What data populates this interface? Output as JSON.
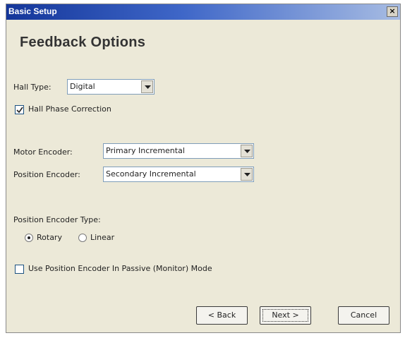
{
  "window": {
    "title": "Basic Setup",
    "close_glyph": "×"
  },
  "heading": "Feedback Options",
  "hall_type": {
    "label": "Hall Type:",
    "value": "Digital"
  },
  "hall_phase_correction": {
    "label": "Hall Phase Correction",
    "checked": true
  },
  "motor_encoder": {
    "label": "Motor Encoder:",
    "value": "Primary Incremental"
  },
  "position_encoder": {
    "label": "Position Encoder:",
    "value": "Secondary Incremental"
  },
  "position_encoder_type": {
    "label": "Position Encoder Type:",
    "options": [
      "Rotary",
      "Linear"
    ],
    "selected": "Rotary"
  },
  "passive_mode": {
    "label": "Use Position Encoder In Passive (Monitor) Mode",
    "checked": false
  },
  "buttons": {
    "back": "< Back",
    "next": "Next >",
    "cancel": "Cancel"
  }
}
